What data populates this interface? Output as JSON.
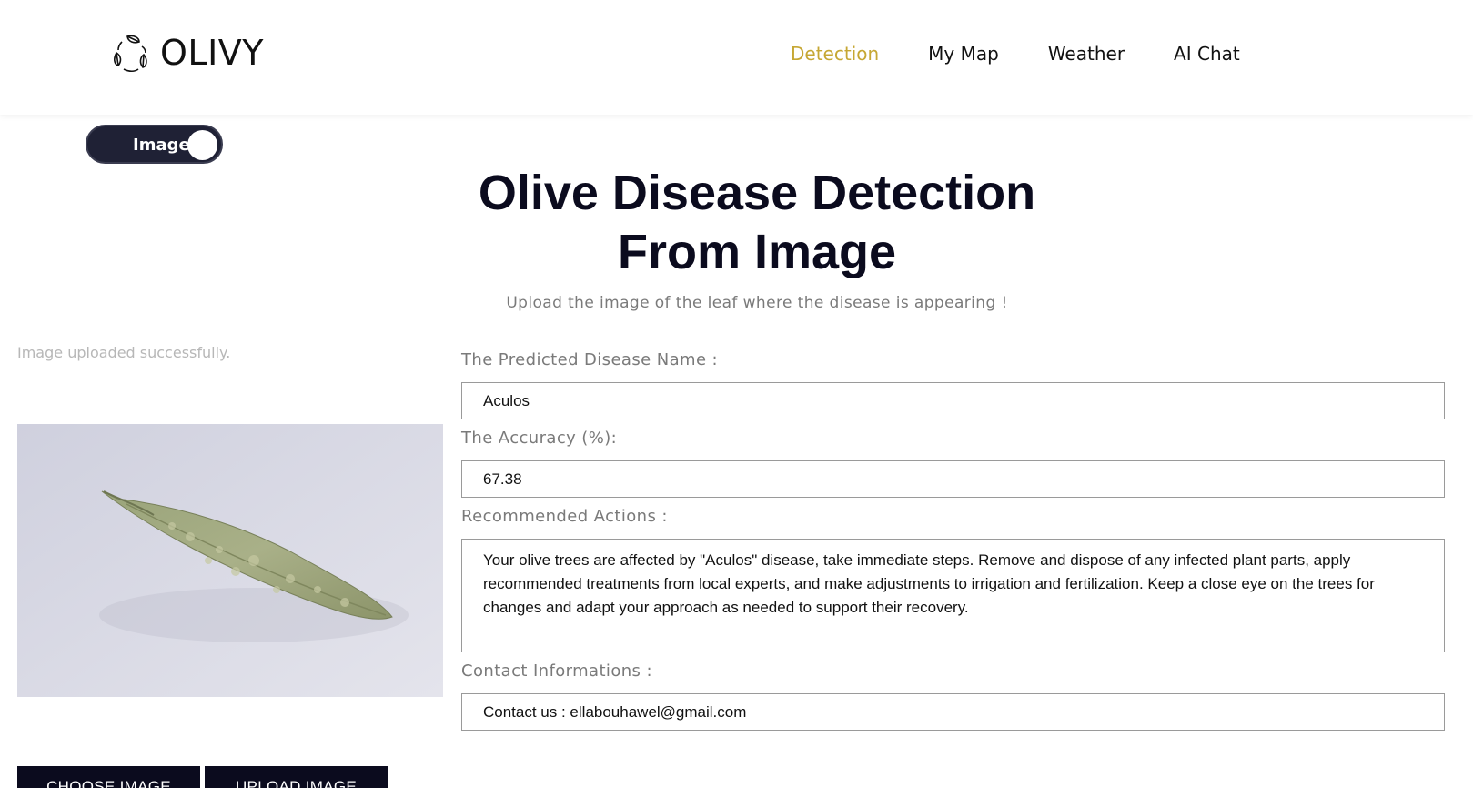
{
  "brand": {
    "name": "OLIVY",
    "logo_icon": "leaf-cycle-icon"
  },
  "nav": {
    "items": [
      {
        "label": "Detection",
        "active": true
      },
      {
        "label": "My Map",
        "active": false
      },
      {
        "label": "Weather",
        "active": false
      },
      {
        "label": "AI Chat",
        "active": false
      }
    ],
    "active_color": "#c6a734"
  },
  "mode_toggle": {
    "label": "Image"
  },
  "page": {
    "title_line1": "Olive Disease Detection",
    "title_line2": "From Image",
    "subtitle": "Upload the image of the leaf where the disease is appearing !"
  },
  "upload": {
    "status": "Image uploaded successfully.",
    "choose_label": "CHOOSE IMAGE",
    "upload_label": "UPLOAD IMAGE"
  },
  "results": {
    "disease_label": "The Predicted Disease Name :",
    "disease_value": "Aculos",
    "accuracy_label": "The Accuracy (%):",
    "accuracy_value": "67.38",
    "actions_label": "Recommended Actions :",
    "actions_value": "Your olive trees are affected by \"Aculos\" disease, take immediate steps. Remove and dispose of any infected plant parts, apply recommended treatments from local experts, and make adjustments to irrigation and fertilization. Keep a close eye on the trees for changes and adapt your approach as needed to support their recovery.",
    "contact_label": "Contact Informations :",
    "contact_value": "Contact us : ellabouhawel@gmail.com"
  }
}
